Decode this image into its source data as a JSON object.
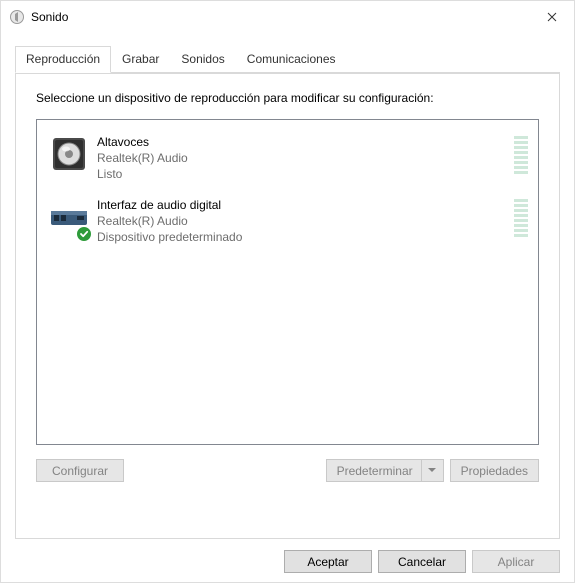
{
  "window": {
    "title": "Sonido"
  },
  "tabs": {
    "playback": "Reproducción",
    "record": "Grabar",
    "sounds": "Sonidos",
    "comms": "Comunicaciones"
  },
  "instruction": "Seleccione un dispositivo de reproducción para modificar su configuración:",
  "devices": [
    {
      "name": "Altavoces",
      "driver": "Realtek(R) Audio",
      "status": "Listo",
      "default": false
    },
    {
      "name": "Interfaz de audio digital",
      "driver": "Realtek(R) Audio",
      "status": "Dispositivo predeterminado",
      "default": true
    }
  ],
  "buttons": {
    "configure": "Configurar",
    "setdefault": "Predeterminar",
    "properties": "Propiedades",
    "ok": "Aceptar",
    "cancel": "Cancelar",
    "apply": "Aplicar"
  }
}
